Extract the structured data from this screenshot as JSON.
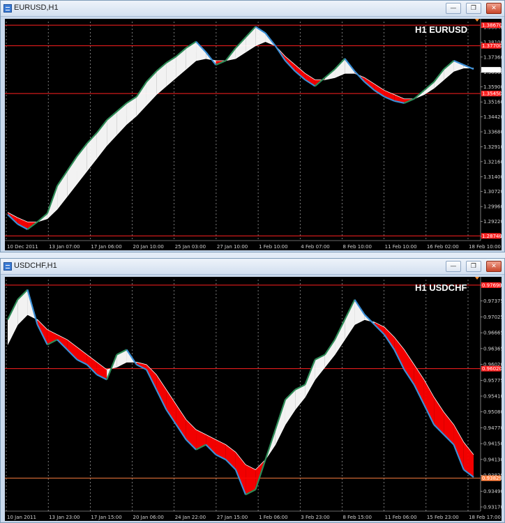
{
  "colors": {
    "background": "#000000",
    "bull": "#ffffff",
    "bear": "#ff0000",
    "price_up": "#2e8b57",
    "price_down": "#3b8fd6",
    "level": "#ff2020",
    "support": "#ff8040",
    "grid": "#c8c8c8"
  },
  "windows": [
    {
      "title": "EURUSD,H1",
      "symbol_label": "H1 EURUSD",
      "buttons": [
        "minimize",
        "restore",
        "close"
      ],
      "price_axis": [
        "1.38840",
        "1.38100",
        "1.37360",
        "1.36568",
        "1.35900",
        "1.35160",
        "1.34420",
        "1.33680",
        "1.32910",
        "1.32160",
        "1.31400",
        "1.30720",
        "1.29960",
        "1.29220",
        "1.28520"
      ],
      "time_axis": [
        "10 Dec 2011",
        "13 Jan 07:00",
        "17 Jan 06:00",
        "20 Jan 10:00",
        "25 Jan 03:00",
        "27 Jan 10:00",
        "1 Feb 10:00",
        "4 Feb 07:00",
        "8 Feb 10:00",
        "11 Feb 10:00",
        "16 Feb 02:00",
        "18 Feb 10:00"
      ],
      "levels": [
        {
          "price": "1.38670",
          "tag": "1.38670",
          "color": "#ff2020"
        },
        {
          "price": "1.37700",
          "tag": "1.37700",
          "color": "#ff2020"
        },
        {
          "price": "1.35450",
          "tag": "1.35450",
          "color": "#ff2020"
        },
        {
          "price": "1.36568",
          "tag": "1.36568",
          "color": "#ffffff"
        },
        {
          "price": "1.28740",
          "tag": "1.28740",
          "color": "#ff2020"
        }
      ],
      "chart_data": {
        "type": "line",
        "ylim": [
          1.2852,
          1.3884
        ],
        "close": [
          1.2975,
          1.293,
          1.2905,
          1.294,
          1.298,
          1.311,
          1.318,
          1.325,
          1.331,
          1.336,
          1.342,
          1.346,
          1.35,
          1.353,
          1.36,
          1.365,
          1.369,
          1.372,
          1.376,
          1.379,
          1.374,
          1.368,
          1.37,
          1.376,
          1.381,
          1.386,
          1.383,
          1.377,
          1.37,
          1.365,
          1.361,
          1.358,
          1.362,
          1.366,
          1.371,
          1.365,
          1.36,
          1.356,
          1.353,
          1.351,
          1.35,
          1.352,
          1.356,
          1.36,
          1.366,
          1.37,
          1.368,
          1.366
        ],
        "trend": [
          1.2985,
          1.296,
          1.294,
          1.294,
          1.2955,
          1.3,
          1.306,
          1.312,
          1.318,
          1.324,
          1.33,
          1.335,
          1.34,
          1.344,
          1.349,
          1.354,
          1.358,
          1.362,
          1.366,
          1.37,
          1.371,
          1.37,
          1.37,
          1.371,
          1.374,
          1.377,
          1.379,
          1.377,
          1.372,
          1.368,
          1.364,
          1.361,
          1.361,
          1.362,
          1.364,
          1.364,
          1.362,
          1.359,
          1.356,
          1.354,
          1.352,
          1.352,
          1.354,
          1.357,
          1.361,
          1.365,
          1.3665,
          1.3665
        ]
      }
    },
    {
      "title": "USDCHF,H1",
      "symbol_label": "H1 USDCHF",
      "buttons": [
        "minimize",
        "restore",
        "close"
      ],
      "price_axis": [
        "0.97640",
        "0.97375",
        "0.97025",
        "0.96665",
        "0.96365",
        "0.96020",
        "0.95775",
        "0.95410",
        "0.95080",
        "0.94770",
        "0.94150",
        "0.94130",
        "0.93829",
        "0.93490",
        "0.93170"
      ],
      "time_axis": [
        "10 Jan 2011",
        "13 Jan 23:00",
        "17 Jan 15:00",
        "20 Jan 06:00",
        "24 Jan 22:00",
        "27 Jan 15:00",
        "1 Feb 06:00",
        "3 Feb 23:00",
        "8 Feb 15:00",
        "11 Feb 06:00",
        "15 Feb 23:00",
        "18 Feb 17:00"
      ],
      "levels": [
        {
          "price": "0.97690",
          "tag": "0.97690",
          "color": "#ff2020"
        },
        {
          "price": "0.96020",
          "tag": "0.96020",
          "color": "#ff2020"
        },
        {
          "price": "0.93829",
          "tag": "0.93829",
          "color": "#ff8040"
        }
      ],
      "chart_data": {
        "type": "line",
        "ylim": [
          0.9317,
          0.978
        ],
        "close": [
          0.97,
          0.974,
          0.976,
          0.969,
          0.965,
          0.966,
          0.964,
          0.962,
          0.961,
          0.959,
          0.958,
          0.963,
          0.964,
          0.961,
          0.96,
          0.956,
          0.952,
          0.949,
          0.946,
          0.944,
          0.945,
          0.943,
          0.942,
          0.94,
          0.935,
          0.936,
          0.942,
          0.948,
          0.954,
          0.956,
          0.957,
          0.962,
          0.963,
          0.966,
          0.97,
          0.974,
          0.971,
          0.969,
          0.967,
          0.964,
          0.96,
          0.957,
          0.953,
          0.949,
          0.947,
          0.945,
          0.94,
          0.9385
        ],
        "trend": [
          0.965,
          0.969,
          0.971,
          0.97,
          0.968,
          0.967,
          0.966,
          0.9645,
          0.963,
          0.9615,
          0.96,
          0.9605,
          0.9615,
          0.9615,
          0.961,
          0.959,
          0.956,
          0.953,
          0.95,
          0.948,
          0.947,
          0.946,
          0.945,
          0.9435,
          0.941,
          0.94,
          0.942,
          0.945,
          0.949,
          0.952,
          0.9545,
          0.958,
          0.9605,
          0.963,
          0.966,
          0.969,
          0.97,
          0.9695,
          0.9685,
          0.9665,
          0.964,
          0.961,
          0.958,
          0.9545,
          0.9515,
          0.949,
          0.9455,
          0.943
        ]
      }
    }
  ]
}
